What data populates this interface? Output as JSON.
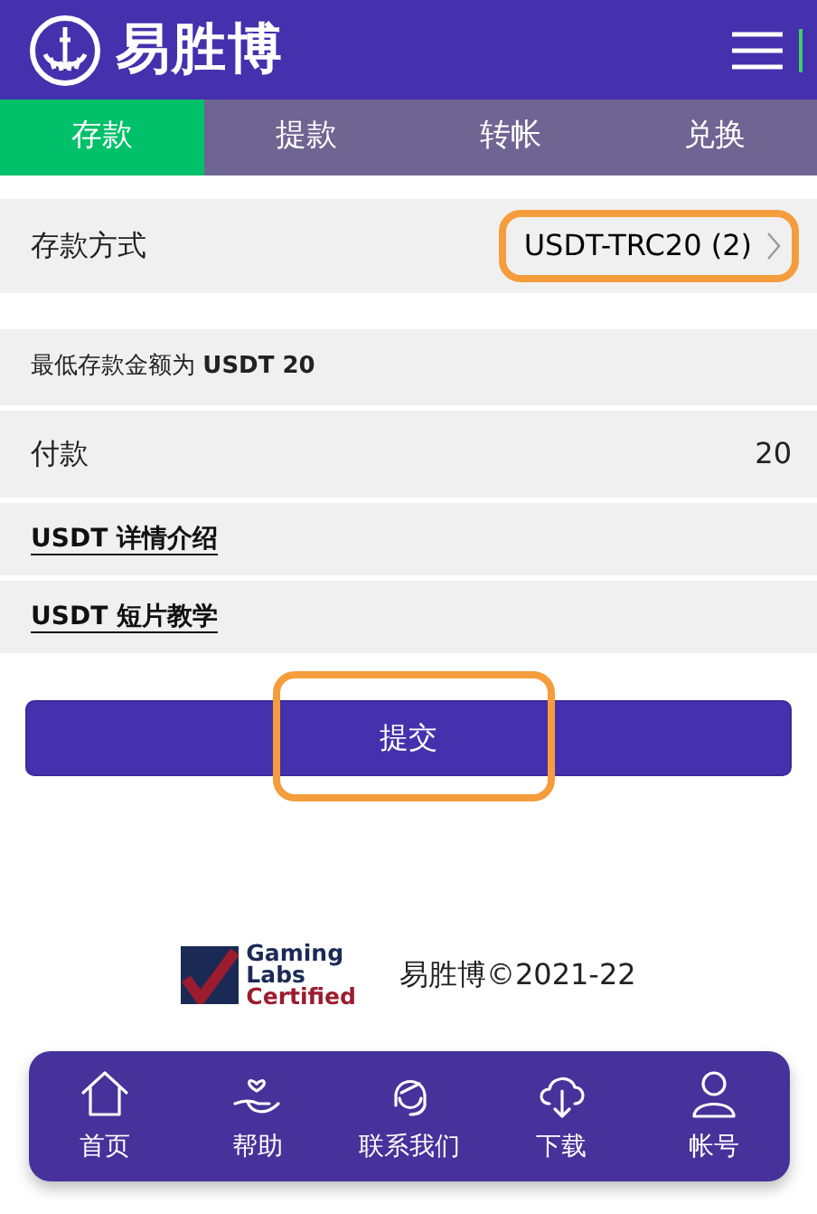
{
  "header": {
    "brand": "易胜博"
  },
  "tabs": [
    {
      "label": "存款",
      "selected": true
    },
    {
      "label": "提款",
      "selected": false
    },
    {
      "label": "转帐",
      "selected": false
    },
    {
      "label": "兑换",
      "selected": false
    }
  ],
  "method": {
    "label": "存款方式",
    "value": "USDT-TRC20 (2)",
    "highlighted": true
  },
  "minimum_note": "最低存款金额为 **USDT 20**",
  "payment": {
    "label": "付款",
    "value": "20"
  },
  "links": [
    "USDT 详情介绍",
    "USDT 短片教学"
  ],
  "submit": {
    "label": "提交",
    "highlighted": true
  },
  "footer": {
    "badge_lines": [
      "Gaming",
      "Labs",
      "Certified"
    ],
    "copyright": "易胜博©2021-22"
  },
  "bottom_nav": [
    {
      "kind": "home",
      "label": "首页"
    },
    {
      "kind": "help",
      "label": "帮助"
    },
    {
      "kind": "support",
      "label": "联系我们"
    },
    {
      "kind": "download",
      "label": "下载"
    },
    {
      "kind": "account",
      "label": "帐号"
    }
  ]
}
